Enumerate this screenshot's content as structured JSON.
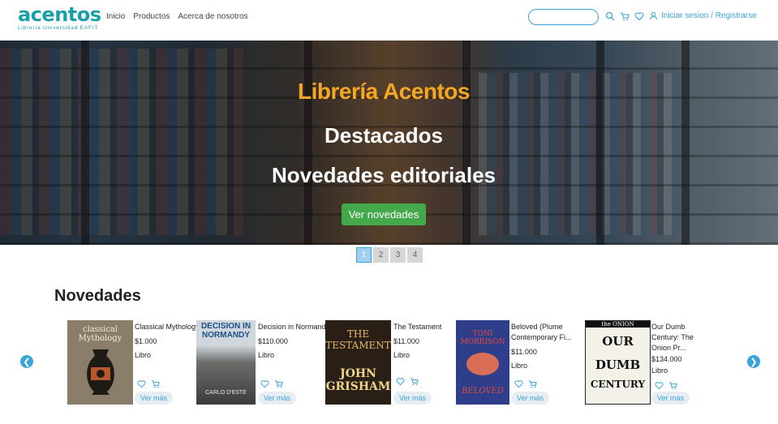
{
  "header": {
    "logo": "acentos",
    "logo_sub": "Librería Universidad EAFIT",
    "nav": [
      "Inicio",
      "Productos",
      "Acerca de nosotros"
    ],
    "search_placeholder": "",
    "login_label": "Iniciar sesion / Registrarse",
    "accent": "#3aa3d8"
  },
  "hero": {
    "title": "Librería Acentos",
    "subtitle1": "Destacados",
    "subtitle2": "Novedades editoriales",
    "button": "Ver novedades",
    "title_color": "#f5a623",
    "button_color": "#43a94b"
  },
  "pager": [
    "1",
    "2",
    "3",
    "4"
  ],
  "section": {
    "title": "Novedades",
    "products": [
      {
        "name": "Classical Mythology",
        "price": "$1.000",
        "type": "Libro",
        "cover_text": [
          "classical",
          "Mythology"
        ],
        "action": "Ver más"
      },
      {
        "name": "Decision in Normandy",
        "price": "$110.000",
        "type": "Libro",
        "cover_text": [
          "DECISION IN",
          "NORMANDY",
          "CARLO D'ESTE"
        ],
        "action": "Ver más"
      },
      {
        "name": "The Testament",
        "price": "$11.000",
        "type": "Libro",
        "cover_text": [
          "THE",
          "TESTAMENT",
          "JOHN",
          "GRISHAM"
        ],
        "action": "Ver más"
      },
      {
        "name": "Beloved (Plume Contemporary Fi...",
        "price": "$11.000",
        "type": "Libro",
        "cover_text": [
          "TONI",
          "MORRISON",
          "BELOVED"
        ],
        "action": "Ver más"
      },
      {
        "name": "Our Dumb Century: The Onion Pr...",
        "price": "$134.000",
        "type": "Libro",
        "cover_text": [
          "the ONION",
          "OUR",
          "DUMB",
          "CENTURY"
        ],
        "action": "Ver más"
      }
    ]
  }
}
